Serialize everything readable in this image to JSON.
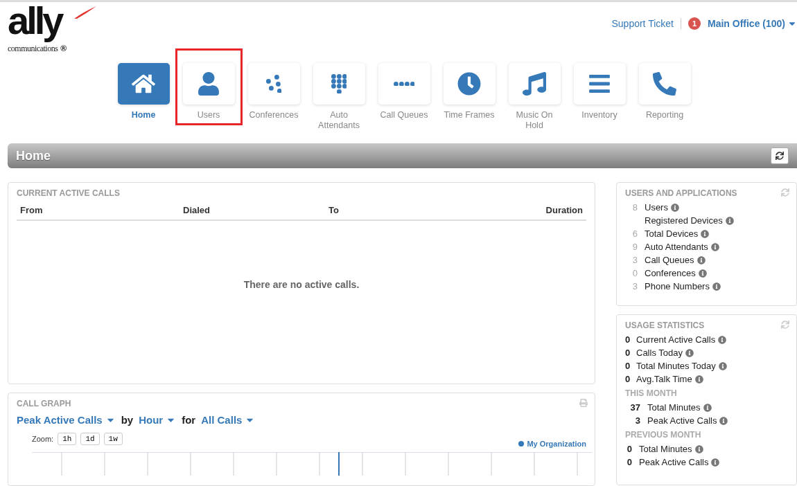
{
  "logo": {
    "wordmark": "ally",
    "tagline": "communications",
    "mark": "®"
  },
  "header_links": {
    "support": "Support Ticket",
    "badge": "1",
    "office": "Main Office (100)"
  },
  "nav": [
    {
      "label": "Home",
      "selected": true,
      "highlighted": false
    },
    {
      "label": "Users",
      "selected": false,
      "highlighted": true
    },
    {
      "label": "Conferences",
      "selected": false,
      "highlighted": false
    },
    {
      "label": "Auto Attendants",
      "selected": false,
      "highlighted": false
    },
    {
      "label": "Call Queues",
      "selected": false,
      "highlighted": false
    },
    {
      "label": "Time Frames",
      "selected": false,
      "highlighted": false
    },
    {
      "label": "Music On Hold",
      "selected": false,
      "highlighted": false
    },
    {
      "label": "Inventory",
      "selected": false,
      "highlighted": false
    },
    {
      "label": "Reporting",
      "selected": false,
      "highlighted": false
    }
  ],
  "page_title": "Home",
  "active_calls": {
    "title": "CURRENT ACTIVE CALLS",
    "columns": [
      "From",
      "Dialed",
      "To",
      "Duration"
    ],
    "empty_message": "There are no active calls."
  },
  "call_graph": {
    "title": "CALL GRAPH",
    "metric": "Peak Active Calls",
    "by": "by",
    "period": "Hour",
    "for": "for",
    "filter": "All Calls",
    "zoom_label": "Zoom:",
    "zoom_buttons": [
      "1h",
      "1d",
      "1w"
    ],
    "legend": "My Organization"
  },
  "users_and_applications": {
    "title": "USERS AND APPLICATIONS",
    "items": [
      {
        "count": "8",
        "label": "Users"
      },
      {
        "label": "Registered Devices"
      },
      {
        "count": "6",
        "label": "Total Devices"
      },
      {
        "count": "9",
        "label": "Auto Attendants"
      },
      {
        "count": "3",
        "label": "Call Queues"
      },
      {
        "count": "0",
        "label": "Conferences"
      },
      {
        "count": "3",
        "label": "Phone Numbers"
      }
    ]
  },
  "usage_statistics": {
    "title": "USAGE STATISTICS",
    "groups": [
      {
        "items": [
          {
            "count": "0",
            "label": "Current Active Calls"
          },
          {
            "count": "0",
            "label": "Calls Today"
          },
          {
            "count": "0",
            "label": "Total Minutes Today"
          },
          {
            "count": "0",
            "label": "Avg.Talk Time"
          }
        ]
      },
      {
        "heading": "THIS MONTH",
        "items": [
          {
            "count": "37",
            "label": "Total Minutes"
          },
          {
            "count": "3",
            "label": "Peak Active Calls"
          }
        ]
      },
      {
        "heading": "PREVIOUS MONTH",
        "items": [
          {
            "count": "0",
            "label": "Total Minutes"
          },
          {
            "count": "0",
            "label": "Peak Active Calls"
          }
        ]
      }
    ]
  }
}
